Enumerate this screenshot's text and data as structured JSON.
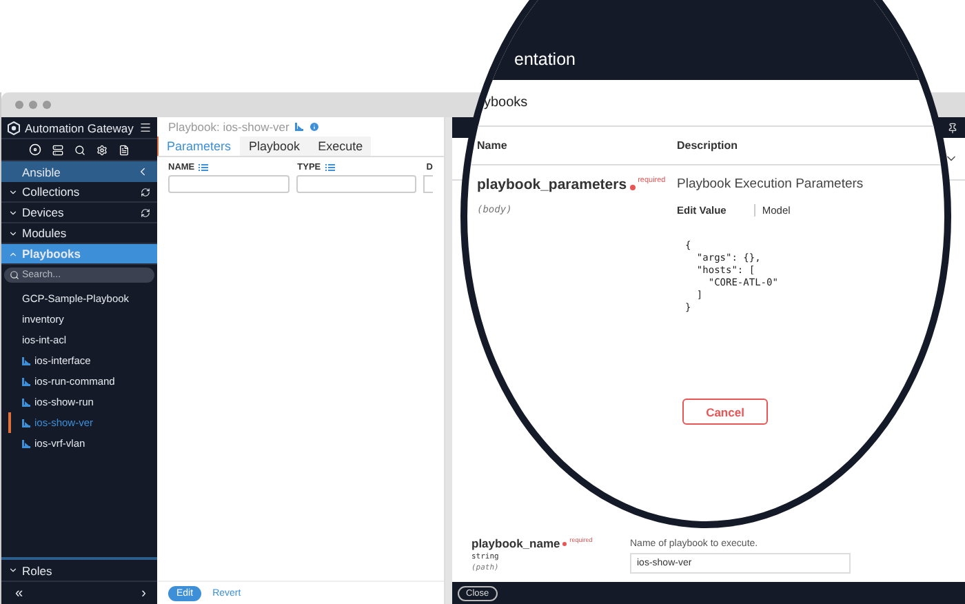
{
  "sidebar": {
    "app_title": "Automation Gateway",
    "section": "Ansible",
    "groups": [
      {
        "label": "Collections",
        "expanded": false,
        "refresh": true
      },
      {
        "label": "Devices",
        "expanded": false,
        "refresh": true
      },
      {
        "label": "Modules",
        "expanded": false,
        "refresh": false
      },
      {
        "label": "Playbooks",
        "expanded": true,
        "refresh": false
      }
    ],
    "search": {
      "placeholder": "Search..."
    },
    "items": [
      {
        "label": "GCP-Sample-Playbook",
        "kind": "plain",
        "selected": false
      },
      {
        "label": "inventory",
        "kind": "plain",
        "selected": false
      },
      {
        "label": "ios-int-acl",
        "kind": "plain",
        "selected": false
      },
      {
        "label": "ios-interface",
        "kind": "playbook",
        "selected": false
      },
      {
        "label": "ios-run-command",
        "kind": "playbook",
        "selected": false
      },
      {
        "label": "ios-show-run",
        "kind": "playbook",
        "selected": false
      },
      {
        "label": "ios-show-ver",
        "kind": "playbook",
        "selected": true
      },
      {
        "label": "ios-vrf-vlan",
        "kind": "playbook",
        "selected": false
      }
    ],
    "bottom_group": {
      "label": "Roles",
      "expanded": false
    },
    "footer": {
      "collapse": "«",
      "next": "›"
    }
  },
  "main": {
    "title": "Playbook: ios-show-ver",
    "tabs": [
      {
        "label": "Parameters",
        "selected": true
      },
      {
        "label": "Playbook",
        "selected": false
      },
      {
        "label": "Execute",
        "selected": false
      }
    ],
    "columns": [
      "NAME",
      "TYPE",
      "D"
    ],
    "edit": "Edit",
    "revert": "Revert"
  },
  "doc_panel": {
    "param": {
      "name": "playbook_name",
      "required": "required",
      "type": "string",
      "location": "(path)",
      "description": "Name of playbook to execute.",
      "value": "ios-show-ver"
    },
    "close": "Close"
  },
  "magnifier": {
    "header": "entation",
    "section": "ybooks",
    "columns": [
      "Name",
      "Description"
    ],
    "param": {
      "name": "playbook_parameters",
      "required": "required",
      "location": "(body)",
      "description": "Playbook Execution Parameters",
      "value_tabs": [
        {
          "label": "Edit Value",
          "selected": true
        },
        {
          "label": "Model",
          "selected": false
        }
      ],
      "code": "{\n  \"args\": {},\n  \"hosts\": [\n    \"CORE-ATL-0\"\n  ]\n}"
    },
    "cancel": "Cancel"
  }
}
